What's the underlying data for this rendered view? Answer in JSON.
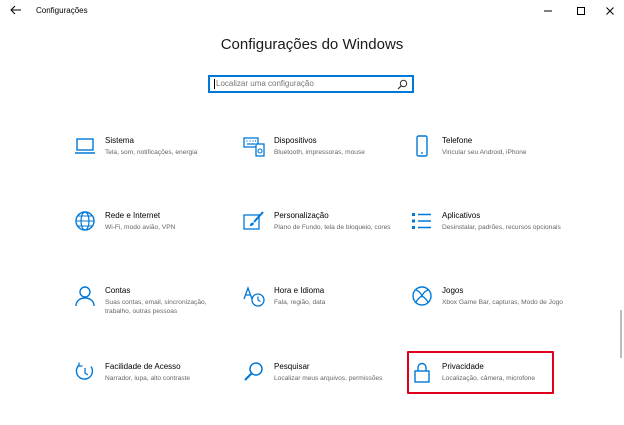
{
  "window": {
    "title": "Configurações",
    "back_glyph": "←",
    "minimize_glyph": "—",
    "maximize_glyph": "□",
    "close_glyph": "✕"
  },
  "heading": "Configurações do Windows",
  "search": {
    "placeholder": "Localizar uma configuração",
    "icon": "search-icon"
  },
  "accent_color": "#0078d7",
  "highlight_color": "#e0001b",
  "tiles": [
    {
      "title": "Sistema",
      "desc": "Tela, som, notificações, energia",
      "icon": "laptop-icon"
    },
    {
      "title": "Dispositivos",
      "desc": "Bluetooth, impressoras, mouse",
      "icon": "keyboard-speaker-icon"
    },
    {
      "title": "Telefone",
      "desc": "Vincular seu Android, iPhone",
      "icon": "phone-icon"
    },
    {
      "title": "Rede e Internet",
      "desc": "Wi-Fi, modo avião, VPN",
      "icon": "globe-icon"
    },
    {
      "title": "Personalização",
      "desc": "Plano de Fundo, tela de bloqueio, cores",
      "icon": "paint-brush-icon"
    },
    {
      "title": "Aplicativos",
      "desc": "Desinstalar, padrões, recursos opcionais",
      "icon": "apps-list-icon"
    },
    {
      "title": "Contas",
      "desc": "Suas contas, email, sincronização, trabalho, outras pessoas",
      "icon": "person-icon"
    },
    {
      "title": "Hora e Idioma",
      "desc": "Fala, região, data",
      "icon": "time-language-icon"
    },
    {
      "title": "Jogos",
      "desc": "Xbox Game Bar, capturas, Modo de Jogo",
      "icon": "xbox-icon"
    },
    {
      "title": "Facilidade de Acesso",
      "desc": "Narrador, lupa, alto contraste",
      "icon": "ease-of-access-icon"
    },
    {
      "title": "Pesquisar",
      "desc": "Localizar meus arquivos, permissões",
      "icon": "magnifier-icon"
    },
    {
      "title": "Privacidade",
      "desc": "Localização, câmera, microfone",
      "icon": "lock-icon",
      "highlighted": true
    }
  ]
}
